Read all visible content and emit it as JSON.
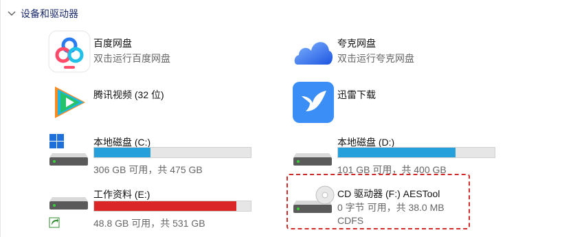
{
  "section": {
    "title": "设备和驱动器"
  },
  "items": {
    "baidu": {
      "name": "百度网盘",
      "sub": "双击运行百度网盘"
    },
    "quark": {
      "name": "夸克网盘",
      "sub": "双击运行夸克网盘"
    },
    "tencent": {
      "name": "腾讯视频 (32 位)"
    },
    "xunlei": {
      "name": "迅雷下载"
    },
    "disk_c": {
      "name": "本地磁盘 (C:)",
      "sub": "306 GB 可用，共 475 GB",
      "used_fraction": 0.36
    },
    "disk_d": {
      "name": "本地磁盘 (D:)",
      "sub": "101 GB 可用，共 400 GB",
      "used_fraction": 0.75
    },
    "disk_e": {
      "name": "工作资料 (E:)",
      "sub": "48.8 GB 可用，共 531 GB",
      "used_fraction": 0.91
    },
    "cd_f": {
      "name": "CD 驱动器 (F:) AESTool",
      "sub": "0 字节 可用，共 38.0 MB",
      "fs": "CDFS"
    }
  },
  "colors": {
    "bar_normal": "#26a0da",
    "bar_full": "#da2626",
    "selection": "#d12a2a"
  }
}
